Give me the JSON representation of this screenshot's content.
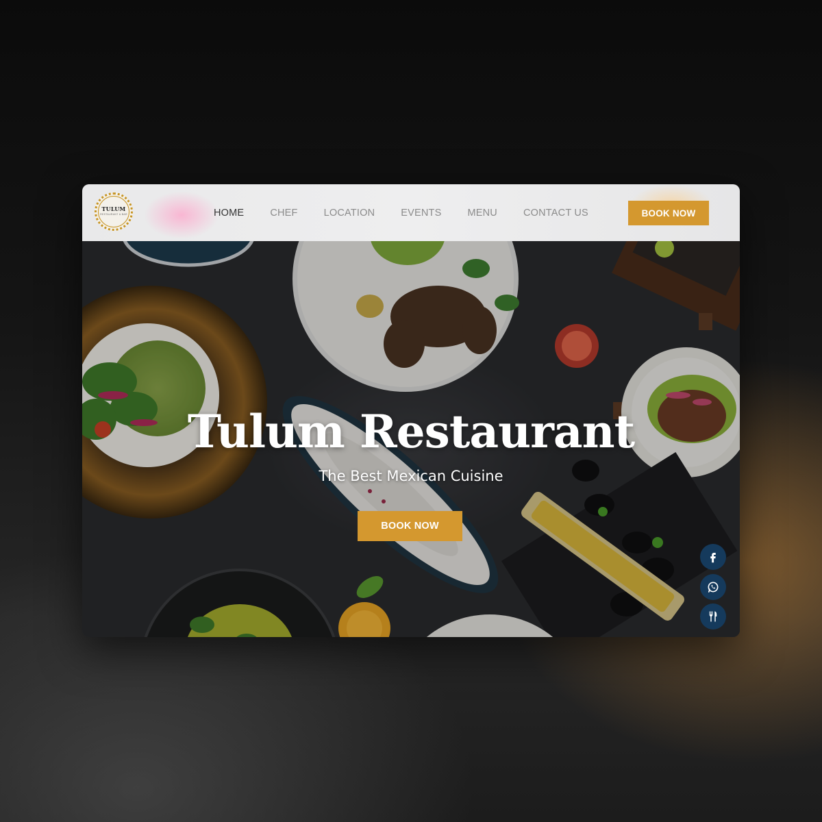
{
  "brand": {
    "logo_name": "TULUM",
    "logo_sub": "RESTAURANT & BAR"
  },
  "nav": {
    "items": [
      {
        "label": "HOME",
        "active": true
      },
      {
        "label": "CHEF",
        "active": false
      },
      {
        "label": "LOCATION",
        "active": false
      },
      {
        "label": "EVENTS",
        "active": false
      },
      {
        "label": "MENU",
        "active": false
      },
      {
        "label": "CONTACT US",
        "active": false
      }
    ],
    "cta_label": "BOOK NOW"
  },
  "hero": {
    "title": "Tulum Restaurant",
    "subtitle": "The Best Mexican Cuisine",
    "cta_label": "BOOK NOW"
  },
  "social": [
    {
      "icon": "facebook-icon"
    },
    {
      "icon": "whatsapp-icon"
    },
    {
      "icon": "fork-knife-icon"
    }
  ],
  "colors": {
    "accent": "#d4982f",
    "social_bg": "#153a5c",
    "nav_bg": "#ececed"
  }
}
